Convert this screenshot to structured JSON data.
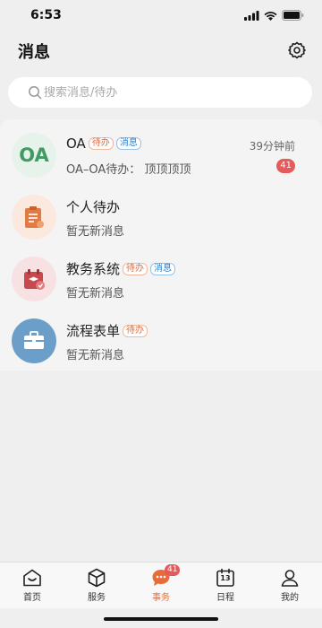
{
  "status_bar": {
    "time": "6:53"
  },
  "header": {
    "title": "消息"
  },
  "search": {
    "placeholder": "搜索消息/待办"
  },
  "messages": [
    {
      "title": "OA",
      "tags": [
        "待办",
        "消息"
      ],
      "subtitle": "OA–OA待办：  顶顶顶顶",
      "time": "39分钟前",
      "badge": "41",
      "avatar_text": "OA",
      "avatar_color": "#e6f2ea",
      "icon": "oa-logo-icon"
    },
    {
      "title": "个人待办",
      "tags": [],
      "subtitle": "暂无新消息",
      "avatar_color": "#fbe9df",
      "icon": "personal-todo-icon"
    },
    {
      "title": "教务系统",
      "tags": [
        "待办",
        "消息"
      ],
      "subtitle": "暂无新消息",
      "avatar_color": "#f8e1e2",
      "icon": "academic-system-icon"
    },
    {
      "title": "流程表单",
      "tags": [
        "待办"
      ],
      "subtitle": "暂无新消息",
      "avatar_color": "#6b9fc9",
      "icon": "workflow-briefcase-icon"
    }
  ],
  "tab_bar": {
    "items": [
      {
        "label": "首页",
        "icon": "home-icon"
      },
      {
        "label": "服务",
        "icon": "cube-icon"
      },
      {
        "label": "事务",
        "icon": "chat-bubble-icon",
        "badge": "41",
        "active": true
      },
      {
        "label": "日程",
        "icon": "calendar-icon",
        "calendar_day": "13"
      },
      {
        "label": "我的",
        "icon": "user-icon"
      }
    ]
  },
  "colors": {
    "accent": "#e86c3a",
    "badge": "#e55a5a",
    "oa_green": "#3f9a64",
    "tag_todo": "#e06a3c",
    "tag_msg": "#2f7fc8"
  }
}
